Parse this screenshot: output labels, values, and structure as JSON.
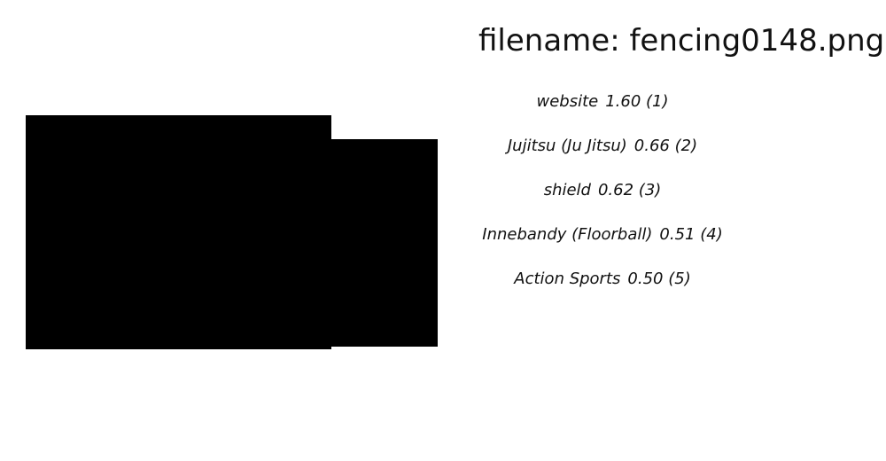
{
  "header": {
    "filename_text": "filename: fencing0148.png"
  },
  "predictions": [
    {
      "label": "website",
      "score": "1.60",
      "rank": "(1)"
    },
    {
      "label": "Jujitsu (Ju Jitsu)",
      "score": "0.66",
      "rank": "(2)"
    },
    {
      "label": "shield",
      "score": "0.62",
      "rank": "(3)"
    },
    {
      "label": "Innebandy (Floorball)",
      "score": "0.51",
      "rank": "(4)"
    },
    {
      "label": "Action Sports",
      "score": "0.50",
      "rank": "(5)"
    }
  ],
  "colors": {
    "image_fill": "#000000",
    "background": "#ffffff",
    "text": "#111111"
  }
}
